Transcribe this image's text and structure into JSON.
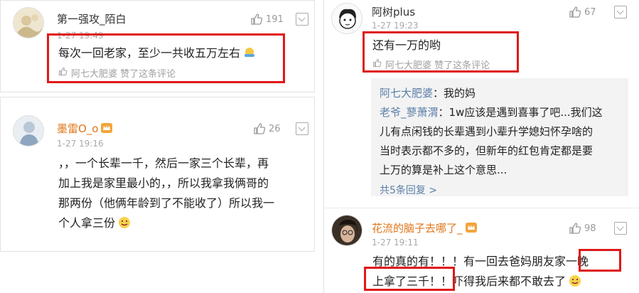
{
  "colors": {
    "highlight_box": "#e01818",
    "orange_name": "#e0761a",
    "reply_name": "#5b7fa8",
    "muted": "#a0a0a0"
  },
  "comments": [
    {
      "username": "第一强攻_陌白",
      "time": "1-27 19:49",
      "likes": "191",
      "text": "每次一回老家，至少一共收五万左右",
      "liked_by": "阿七大肥婆 赞了这条评论"
    },
    {
      "username": "墨雷O_o",
      "time": "1-27 19:16",
      "likes": "26",
      "text_lines": [
        "，，一个长辈一千，然后一家三个长辈，再",
        "加上我是家里最小的，，所以我拿我俩哥的",
        "那两份（他俩年龄到了不能收了）所以我一",
        "个人拿三份"
      ]
    },
    {
      "username": "阿树plus",
      "time": "1-27 19:23",
      "likes": "67",
      "text": "还有一万的哟",
      "liked_by": "阿七大肥婆 赞了这条评论",
      "replies": [
        {
          "name": "阿七大肥婆",
          "text": "：我的妈"
        },
        {
          "name": "老爷_蓼萧渭",
          "text": "：1w应该是遇到喜事了吧...我们这"
        }
      ],
      "reply_continuation": [
        "儿有点闲钱的长辈遇到小辈升学媳妇怀孕啥的",
        "当时表示都不多的，但新年的红包肯定都是要",
        "上万的算是补上这个意思..."
      ],
      "more_replies": "共5条回复 >"
    },
    {
      "username": "花流的脑子去哪了_",
      "time": "1-27 19:11",
      "likes": "98",
      "text_lines": [
        "有的真的有！！！有一回去爸妈朋友家一晚",
        "上拿了三千！！吓得我后来都不敢去了"
      ]
    }
  ]
}
